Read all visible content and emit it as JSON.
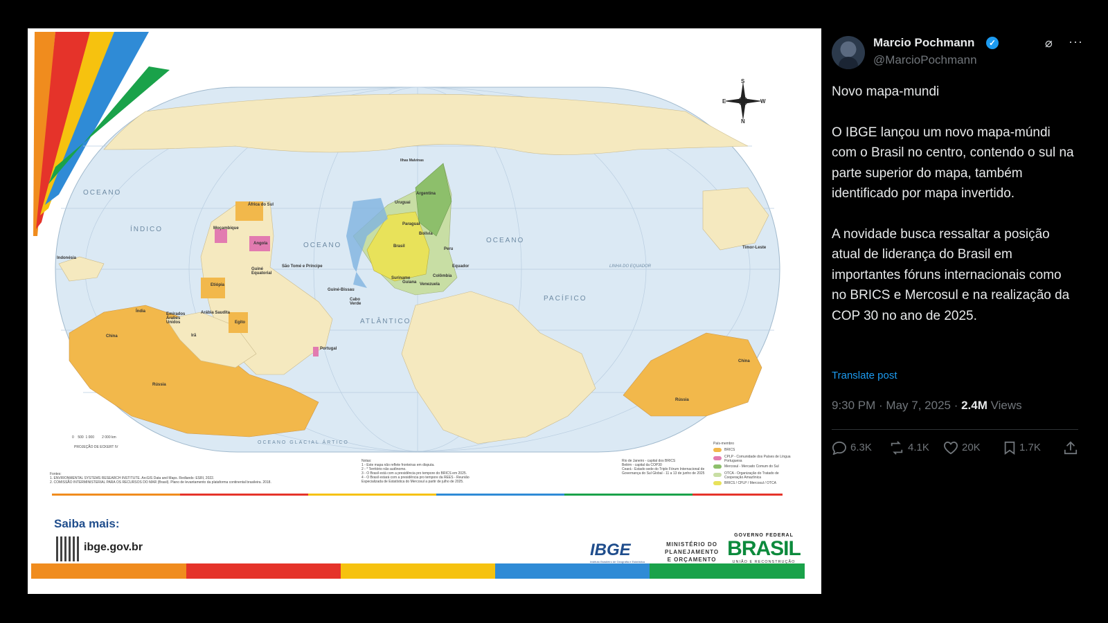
{
  "tweet": {
    "author_name": "Marcio Pochmann",
    "handle": "@MarcioPochmann",
    "verified_badge": "✓",
    "grok_icon": "⌀",
    "more_icon": "···",
    "paragraph_1": "Novo mapa-mundi",
    "paragraph_2": "O IBGE lançou um novo mapa-múndi com o Brasil no centro, contendo o sul na parte superior do mapa, também identificado por mapa invertido.",
    "paragraph_3": "A novidade busca ressaltar a posição atual de liderança do Brasil em importantes fóruns internacionais como no BRICS e Mercosul e na realização da COP 30 no ano de 2025.",
    "translate_label": "Translate post",
    "time": "9:30 PM · May 7, 2025 · ",
    "views_count": "2.4M",
    "views_label": " Views",
    "actions": {
      "replies": "6.3K",
      "reposts": "4.1K",
      "likes": "20K",
      "bookmarks": "1.7K"
    }
  },
  "map_image": {
    "ocean_labels": {
      "indico_1": "OCEANO",
      "indico_2": "ÍNDICO",
      "atlantico_1": "OCEANO",
      "atlantico_2": "ATLÂNTICO",
      "pacifico_1": "OCEANO",
      "pacifico_2": "PACÍFICO",
      "artico": "OCEANO GLACIAL ÁRTICO",
      "equador": "LINHA DO EQUADOR"
    },
    "compass": {
      "s": "S",
      "n": "N",
      "e": "E",
      "w": "W"
    },
    "countries": {
      "brasil": "Brasil",
      "argentina": "Argentina",
      "uruguai": "Uruguai",
      "paraguai": "Paraguai",
      "bolivia": "Bolívia",
      "peru": "Peru",
      "equador_c": "Equador",
      "colombia": "Colômbia",
      "venezuela": "Venezuela",
      "suriname": "Suriname",
      "guiana": "Guiana",
      "malvinas": "Ilhas Malvinas",
      "africa_sul": "África do Sul",
      "mocambique": "Moçambique",
      "angola": "Angola",
      "etiopia": "Etiópia",
      "egito": "Egito",
      "arabia": "Arábia Saudita",
      "emirados": "Emirados Árabes Unidos",
      "ira": "Irã",
      "india": "Índia",
      "china": "China",
      "russia": "Rússia",
      "indonesia": "Indonésia",
      "guine_eq": "Guiné Equatorial",
      "sao_tome": "São Tomé e Príncipe",
      "guine_bissau": "Guiné-Bissau",
      "cabo_verde": "Cabo Verde",
      "portugal": "Portugal",
      "timor": "Timor-Leste",
      "china_e": "China",
      "russia_e": "Rússia"
    },
    "scale": "0    500  1 000        2 000 km",
    "projection": "PROJEÇÃO DE ECKERT IV",
    "sources": "Fontes:\n1. ENVIRONMENTAL SYSTEMS RESEARCH INSTITUTE. ArcGIS Data and Maps. Redlands: ESRI, 2022.\n2. COMISSÃO INTERMINISTERIAL PARA OS RECURSOS DO MAR (Brasil). Plano de levantamento da plataforma continental brasileira. 2018.",
    "notas": "Notas:\n1 - Este mapa não reflete fronteiras em disputa.\n2 - * Território não autônomo.\n3 - O Brasil está com a presidência pro tempore do BRICS em 2025.\n4 - O Brasil estará com a presidência pro tempore da REES - Reunião\n    Especializada de Estatística do Mercosul a partir de julho de 2025.",
    "symbols": "Rio de Janeiro - capital dos BRICS\nBelém - capital da COP30\nCeará - Estado sede do Triplo Fórum Internacional de\nGovernança do Sul Global - 11 a 13 de junho de 2025",
    "legend_title": "País-membro",
    "legend": [
      {
        "label": "BRICS",
        "color": "#f2b84b"
      },
      {
        "label": "CPLP - Comunidade dos Países de Língua Portuguesa",
        "color": "#e27bb0"
      },
      {
        "label": "Mercosul - Mercado Comum do Sul",
        "color": "#8dbf6b"
      },
      {
        "label": "OTCA - Organização do Tratado de Cooperação Amazônica",
        "color": "#c8dea4"
      },
      {
        "label": "BRICS / CPLP / Mercosul / OTCA",
        "color": "#e8e25a"
      }
    ],
    "saiba": "Saiba mais:",
    "site": "ibge.gov.br",
    "ibge_logo": "IBGE",
    "ibge_sub": "Instituto Brasileiro de Geografia e Estatística",
    "ministerio": "MINISTÉRIO DO\nPLANEJAMENTO\nE ORÇAMENTO",
    "gov_top": "GOVERNO FEDERAL",
    "gov_brasil": "BRASIL",
    "gov_sub": "UNIÃO E RECONSTRUÇÃO",
    "colors": {
      "ocean": "#dbe9f4",
      "land": "#f5e9bf",
      "brics": "#f2b84b",
      "cplp": "#e27bb0",
      "mercosul": "#8dbf6b",
      "brasil": "#e8e25a"
    }
  }
}
